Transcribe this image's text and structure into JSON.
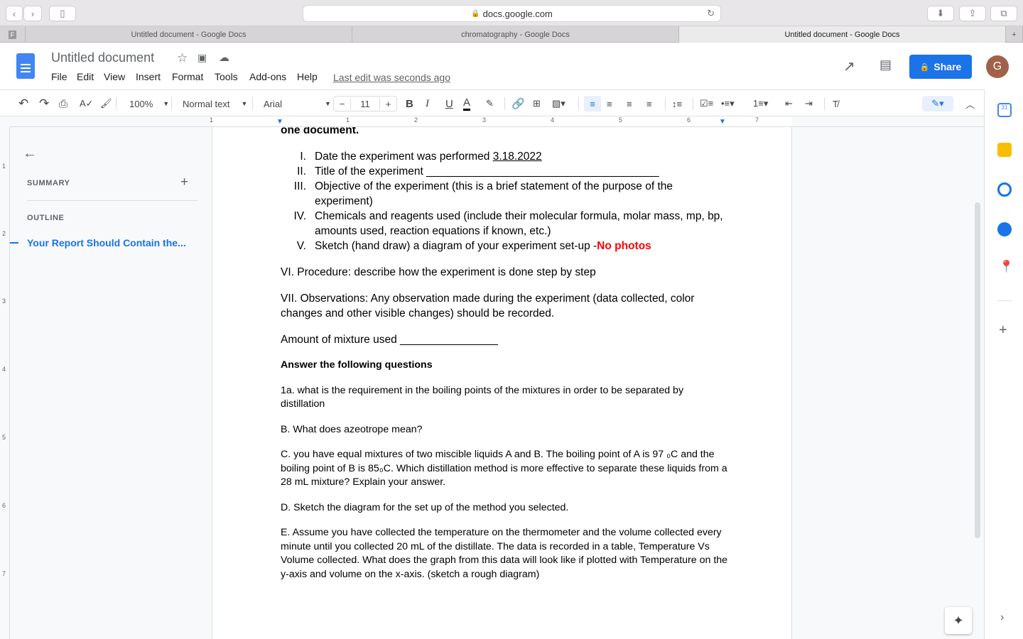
{
  "browser": {
    "url": "docs.google.com",
    "tabs": [
      {
        "title": "Untitled document - Google Docs",
        "active": false
      },
      {
        "title": "chromatography - Google Docs",
        "active": false
      },
      {
        "title": "Untitled document - Google Docs",
        "active": true
      }
    ]
  },
  "header": {
    "doc_title": "Untitled document",
    "menu": [
      "File",
      "Edit",
      "View",
      "Insert",
      "Format",
      "Tools",
      "Add-ons",
      "Help"
    ],
    "last_edit": "Last edit was seconds ago",
    "share": "Share",
    "avatar_letter": "G",
    "share_color": "#1a73e8"
  },
  "toolbar": {
    "zoom": "100%",
    "style": "Normal text",
    "font": "Arial",
    "font_size": "11",
    "minus": "−",
    "plus": "+",
    "bold": "B",
    "italic": "I",
    "underline": "U",
    "text_color": "A"
  },
  "ruler": {
    "labels": [
      "1",
      "1",
      "2",
      "3",
      "4",
      "5",
      "6",
      "7"
    ],
    "vlabels": [
      "1",
      "2",
      "3",
      "4",
      "5",
      "6",
      "7"
    ]
  },
  "outline": {
    "summary": "SUMMARY",
    "add": "+",
    "outline": "OUTLINE",
    "item": "Your Report Should Contain the..."
  },
  "document": {
    "cut_heading": "one document.",
    "list": [
      {
        "n": "I.",
        "text": "Date the experiment was performed ",
        "link": "3.18.2022"
      },
      {
        "n": "II.",
        "text": "Title of the experiment ______________________________________"
      },
      {
        "n": "III.",
        "text": "Objective of the experiment (this is a brief statement of the purpose of the experiment)"
      },
      {
        "n": "IV.",
        "text": "Chemicals and reagents used (include their molecular formula, molar mass, mp, bp, amounts used, reaction equations if known, etc.)"
      },
      {
        "n": "V.",
        "text": "Sketch (hand draw) a diagram of your experiment set-up -",
        "red": "No photos"
      }
    ],
    "procedure": "VI. Procedure: describe how the experiment is done step by step",
    "observations": "VII. Observations: Any observation made during the experiment (data collected, color changes and other visible changes) should be recorded.",
    "amount": "Amount of mixture used ________________",
    "answer_heading": "Answer the following questions",
    "q1a": "1a. what is the requirement in the boiling points of the mixtures in order to be separated by distillation",
    "qB": "B. What does azeotrope mean?",
    "qC": "C. you have equal mixtures of two miscible liquids A and B. The boiling point of A is 97 ₀C and the boiling point of B is 85₀C. Which distillation method is more effective to separate these liquids from a 28 mL mixture? Explain your answer.",
    "qD": "D.  Sketch the diagram for the set up of the method you selected.",
    "qE": "E.  Assume you have collected the temperature on the thermometer and the volume collected every minute until you collected 20 mL of the distillate. The data is recorded in a table, Temperature Vs Volume collected. What does the graph from this data will look like if plotted with Temperature on the y-axis and volume on the x-axis. (sketch a rough diagram)"
  }
}
